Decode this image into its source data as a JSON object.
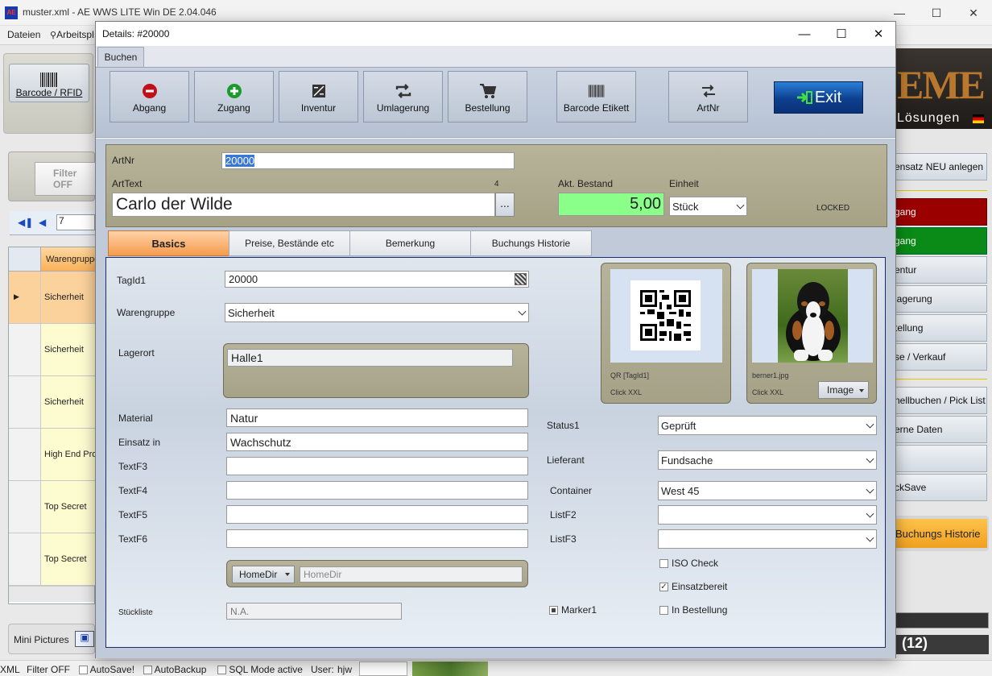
{
  "main_window": {
    "title": "muster.xml - AE WWS LITE Win DE 2.04.046",
    "logo_text": "AE",
    "controls": {
      "minimize": "—",
      "maximize": "☐",
      "close": "✕"
    },
    "menu": [
      "Dateien",
      "Arbeitspl"
    ],
    "toolbar_barcode_label": "Barcode / RFID",
    "filter_label": "Filter OFF",
    "nav_record": "7",
    "grid_header": "Warengruppe",
    "grid_rows": [
      "Sicherheit",
      "Sicherheit",
      "Sicherheit",
      "High End Pro",
      "Top Secret",
      "Top Secret"
    ],
    "brand_text_1": "EME",
    "brand_text_2": "Lösungen",
    "right_buttons": [
      "ensatz NEU anlegen",
      "gang",
      "gang",
      "entur",
      "lagerung",
      "tellung",
      "se / Verkauf",
      "nellbuchen / Pick List",
      "erne Daten",
      "",
      "ckSave"
    ],
    "right_history": "Buchungs Historie",
    "count_label": "(12)",
    "mini_pictures": "Mini Pictures",
    "status": {
      "xml": "XML",
      "filter": "Filter OFF",
      "autosave": "AutoSave!",
      "autobackup": "AutoBackup",
      "sqlmode": "SQL Mode active",
      "user_label": "User:",
      "user": "hjw"
    }
  },
  "dialog": {
    "title": "Details: #20000",
    "tab": "Buchen",
    "ribbon": {
      "abgang": "Abgang",
      "zugang": "Zugang",
      "inventur": "Inventur",
      "umlagerung": "Umlagerung",
      "bestellung": "Bestellung",
      "barcode_etikett": "Barcode Etikett",
      "artnr": "ArtNr",
      "exit": "Exit"
    },
    "header": {
      "artnr_label": "ArtNr",
      "artnr_value": "20000",
      "arttext_label": "ArtText",
      "arttext_value": "Carlo der Wilde",
      "arttext_count": "4",
      "ellipsis": "...",
      "bestand_label": "Akt. Bestand",
      "bestand_value": "5,00",
      "einheit_label": "Einheit",
      "einheit_value": "Stück",
      "locked": "LOCKED"
    },
    "tabs": [
      "Basics",
      "Preise, Bestände etc",
      "Bemerkung",
      "Buchungs Historie"
    ],
    "basics": {
      "tagid_label": "TagId1",
      "tagid_value": "20000",
      "warengruppe_label": "Warengruppe",
      "warengruppe_value": "Sicherheit",
      "lagerort_label": "Lagerort",
      "lagerort_value": "Halle1",
      "material_label": "Material",
      "material_value": "Natur",
      "einsatz_label": "Einsatz in",
      "einsatz_value": "Wachschutz",
      "textf3_label": "TextF3",
      "textf3_value": "",
      "textf4_label": "TextF4",
      "textf4_value": "",
      "textf5_label": "TextF5",
      "textf5_value": "",
      "textf6_label": "TextF6",
      "textf6_value": "",
      "homedir_button": "HomeDir",
      "homedir_placeholder": "HomeDir",
      "stueckliste_label": "Stückliste",
      "stueckliste_value": "N.A.",
      "qr_caption": "QR [TagId1]",
      "qr_click": "Click XXL",
      "image_caption": "berner1.jpg",
      "image_click": "Click XXL",
      "image_button": "Image",
      "status1_label": "Status1",
      "status1_value": "Geprüft",
      "lieferant_label": "Lieferant",
      "lieferant_value": "Fundsache",
      "container_label": "Container",
      "container_value": "West 45",
      "listf2_label": "ListF2",
      "listf2_value": "",
      "listf3_label": "ListF3",
      "listf3_value": "",
      "iso_check": "ISO Check",
      "einsatzbereit": "Einsatzbereit",
      "marker1": "Marker1",
      "in_bestellung": "In Bestellung"
    }
  },
  "colors": {
    "bestand_bg": "#8aff8a",
    "basics_tab": "#f59b4c",
    "exit_blue": "#0e3f8e"
  }
}
